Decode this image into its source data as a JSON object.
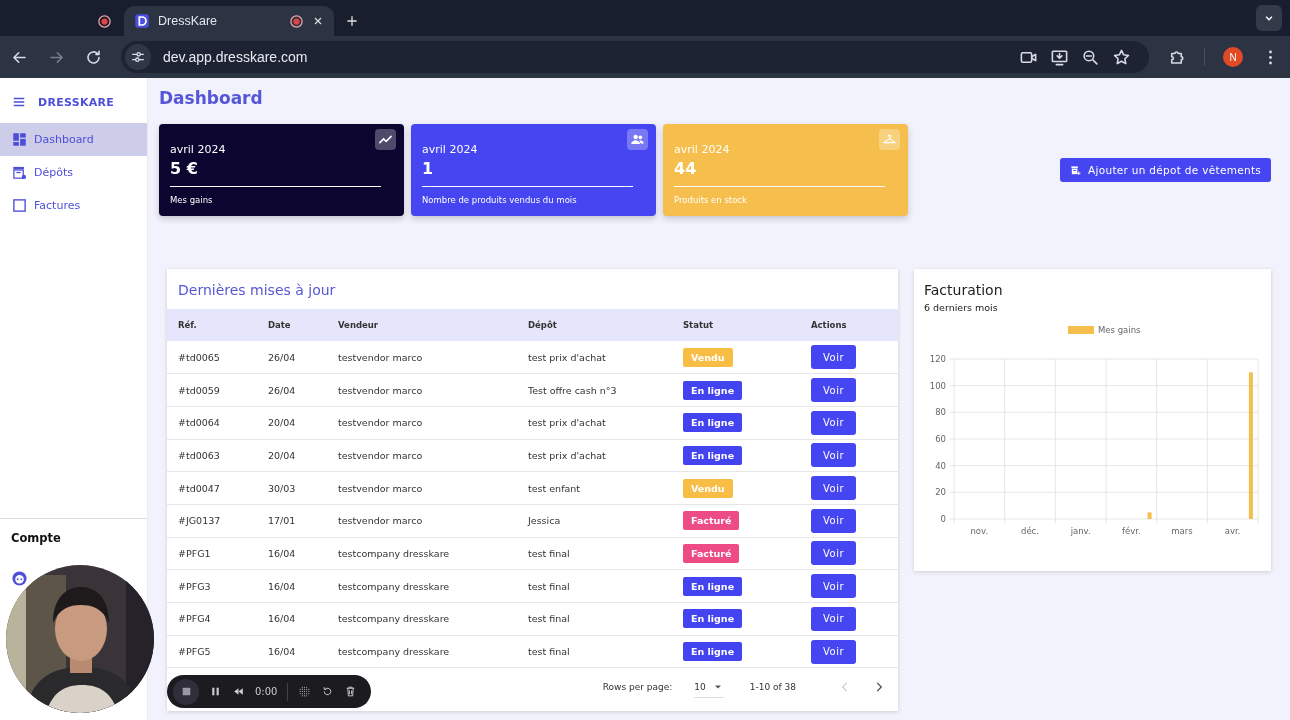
{
  "browser": {
    "tabs": [
      {
        "recording": true,
        "selected": false
      },
      {
        "title": "DressKare",
        "recording": true,
        "selected": true
      }
    ],
    "url": "dev.app.dresskare.com",
    "profile": "N"
  },
  "sidebar": {
    "brand": "DRESSKARE",
    "items": [
      {
        "label": "Dashboard",
        "selected": true
      },
      {
        "label": "Dépôts",
        "selected": false
      },
      {
        "label": "Factures",
        "selected": false
      }
    ],
    "account_title": "Compte"
  },
  "page_title": "Dashboard",
  "stat_cards": [
    {
      "period": "avril 2024",
      "value": "5 €",
      "caption": "Mes gains",
      "color": "#0b0530"
    },
    {
      "period": "avril 2024",
      "value": "1",
      "caption": "Nombre de produits vendus du mois",
      "color": "#4545f2"
    },
    {
      "period": "avril 2024",
      "value": "44",
      "caption": "Produits en stock",
      "color": "#f6bf4d"
    }
  ],
  "add_button": "Ajouter un dépot de vêtements",
  "updates": {
    "title": "Dernières mises à jour",
    "columns": [
      "Réf.",
      "Date",
      "Vendeur",
      "Dépôt",
      "Statut",
      "Actions"
    ],
    "rows": [
      {
        "ref": "#td0065",
        "date": "26/04",
        "vendor": "testvendor marco",
        "depot": "test prix d'achat",
        "status": {
          "label": "Vendu",
          "color": "#f7bd45"
        },
        "action": "Voir"
      },
      {
        "ref": "#td0059",
        "date": "26/04",
        "vendor": "testvendor marco",
        "depot": "Test offre cash n°3",
        "status": {
          "label": "En ligne",
          "color": "#4343ef"
        },
        "action": "Voir"
      },
      {
        "ref": "#td0064",
        "date": "20/04",
        "vendor": "testvendor marco",
        "depot": "test prix d'achat",
        "status": {
          "label": "En ligne",
          "color": "#4343ef"
        },
        "action": "Voir"
      },
      {
        "ref": "#td0063",
        "date": "20/04",
        "vendor": "testvendor marco",
        "depot": "test prix d'achat",
        "status": {
          "label": "En ligne",
          "color": "#4343ef"
        },
        "action": "Voir"
      },
      {
        "ref": "#td0047",
        "date": "30/03",
        "vendor": "testvendor marco",
        "depot": "test enfant",
        "status": {
          "label": "Vendu",
          "color": "#f7bd45"
        },
        "action": "Voir"
      },
      {
        "ref": "#JG0137",
        "date": "17/01",
        "vendor": "testvendor marco",
        "depot": "Jessica",
        "status": {
          "label": "Facturé",
          "color": "#ec4b84"
        },
        "action": "Voir"
      },
      {
        "ref": "#PFG1",
        "date": "16/04",
        "vendor": "testcompany dresskare",
        "depot": "test final",
        "status": {
          "label": "Facturé",
          "color": "#ec4b84"
        },
        "action": "Voir"
      },
      {
        "ref": "#PFG3",
        "date": "16/04",
        "vendor": "testcompany dresskare",
        "depot": "test final",
        "status": {
          "label": "En ligne",
          "color": "#4343ef"
        },
        "action": "Voir"
      },
      {
        "ref": "#PFG4",
        "date": "16/04",
        "vendor": "testcompany dresskare",
        "depot": "test final",
        "status": {
          "label": "En ligne",
          "color": "#4343ef"
        },
        "action": "Voir"
      },
      {
        "ref": "#PFG5",
        "date": "16/04",
        "vendor": "testcompany dresskare",
        "depot": "test final",
        "status": {
          "label": "En ligne",
          "color": "#4343ef"
        },
        "action": "Voir"
      }
    ],
    "rows_per_page_label": "Rows per page:",
    "rows_per_page": "10",
    "range": "1-10 of 38"
  },
  "billing": {
    "title": "Facturation",
    "subtitle": "6 derniers mois",
    "chart_data": {
      "type": "bar",
      "categories": [
        "nov.",
        "déc.",
        "janv.",
        "févr.",
        "mars",
        "avr."
      ],
      "series": [
        {
          "name": "Mes gains",
          "color": "#f6bf4d",
          "values": [
            0,
            0,
            0,
            5,
            0,
            110
          ]
        }
      ],
      "ylim": [
        0,
        120
      ],
      "grid": true,
      "yticks": [
        0,
        20,
        40,
        60,
        80,
        100,
        120
      ]
    }
  },
  "recorder": {
    "time": "0:00"
  }
}
